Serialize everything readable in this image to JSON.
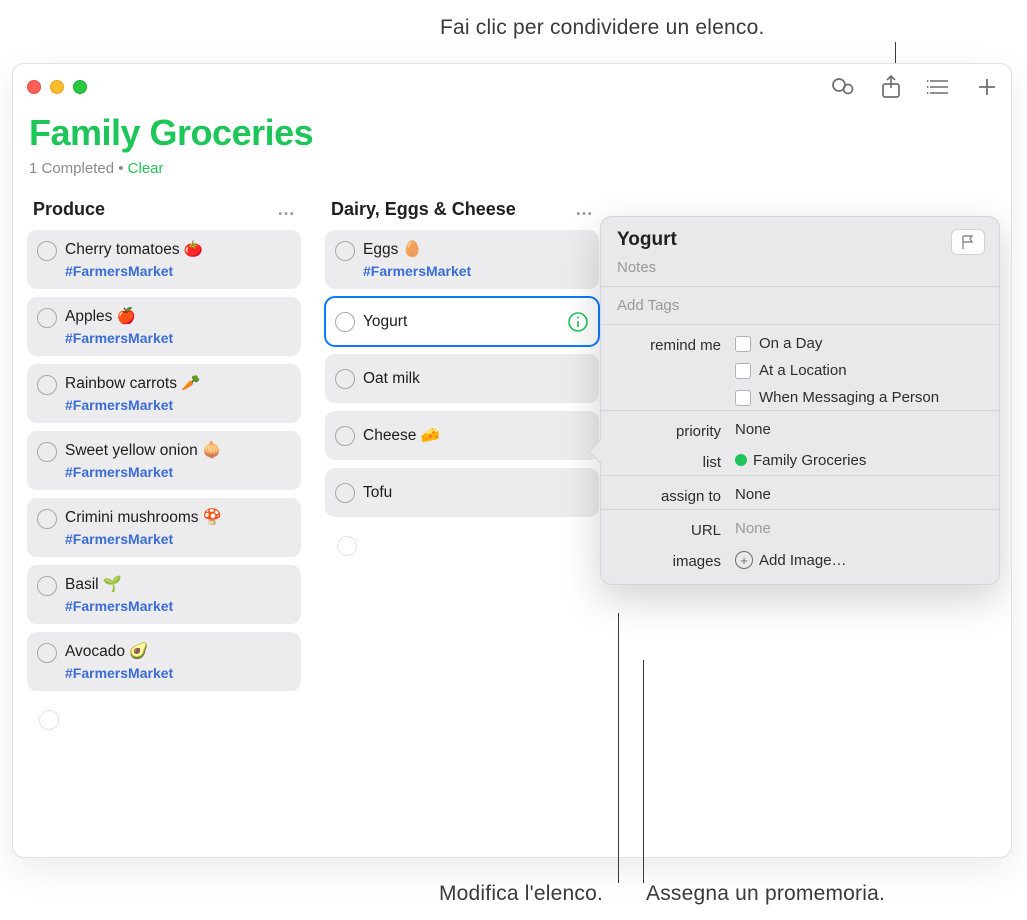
{
  "callouts": {
    "share": "Fai clic per condividere un elenco.",
    "modify_list": "Modifica l'elenco.",
    "assign": "Assegna un promemoria."
  },
  "header": {
    "title": "Family Groceries",
    "completed_text": "1 Completed",
    "separator": "  •  ",
    "clear": "Clear"
  },
  "toolbar_icons": {
    "activity": "activity-icon",
    "share": "share-icon",
    "layout": "column-view-icon",
    "add": "add-icon"
  },
  "columns": [
    {
      "title": "Produce",
      "more": "…",
      "items": [
        {
          "title": "Cherry tomatoes 🍅",
          "tag": "#FarmersMarket"
        },
        {
          "title": "Apples 🍎",
          "tag": "#FarmersMarket"
        },
        {
          "title": "Rainbow carrots 🥕",
          "tag": "#FarmersMarket"
        },
        {
          "title": "Sweet yellow onion 🧅",
          "tag": "#FarmersMarket"
        },
        {
          "title": "Crimini mushrooms 🍄",
          "tag": "#FarmersMarket"
        },
        {
          "title": "Basil 🌱",
          "tag": "#FarmersMarket"
        },
        {
          "title": "Avocado 🥑",
          "tag": "#FarmersMarket"
        }
      ]
    },
    {
      "title": "Dairy, Eggs & Cheese",
      "more": "…",
      "items": [
        {
          "title": "Eggs 🥚",
          "tag": "#FarmersMarket"
        },
        {
          "title": "Yogurt",
          "selected": true
        },
        {
          "title": "Oat milk"
        },
        {
          "title": "Cheese 🧀"
        },
        {
          "title": "Tofu"
        }
      ]
    }
  ],
  "details": {
    "title": "Yogurt",
    "notes_placeholder": "Notes",
    "add_tags_placeholder": "Add Tags",
    "labels": {
      "remind_me": "remind me",
      "priority": "priority",
      "list": "list",
      "assign_to": "assign to",
      "url": "URL",
      "images": "images"
    },
    "remind_options": {
      "on_day": "On a Day",
      "at_loc": "At a Location",
      "msg": "When Messaging a Person"
    },
    "priority_value": "None",
    "list_value": "Family Groceries",
    "assign_value": "None",
    "url_value": "None",
    "add_image": "Add Image…"
  }
}
